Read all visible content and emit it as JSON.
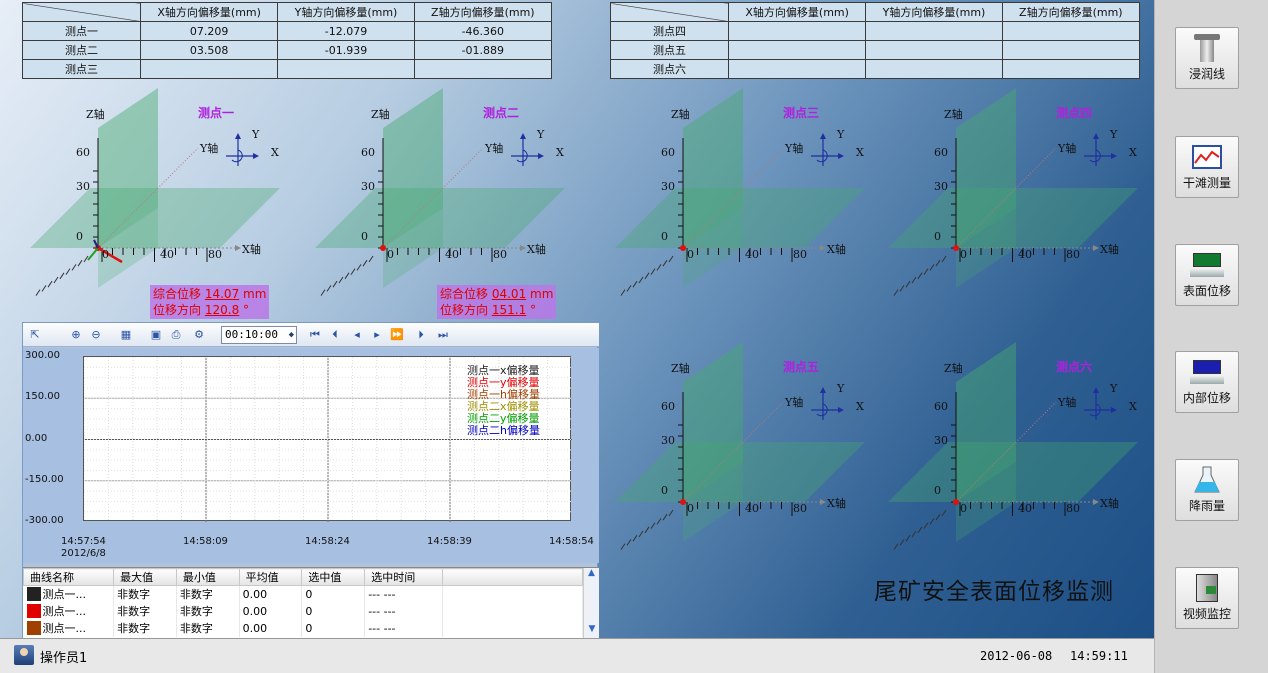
{
  "table_left": {
    "headers": [
      "X轴方向偏移量(mm)",
      "Y轴方向偏移量(mm)",
      "Z轴方向偏移量(mm)"
    ],
    "rows": [
      {
        "name": "测点一",
        "x": "07.209",
        "y": "-12.079",
        "z": "-46.360"
      },
      {
        "name": "测点二",
        "x": "03.508",
        "y": "-01.939",
        "z": "-01.889"
      },
      {
        "name": "测点三",
        "x": "",
        "y": "",
        "z": ""
      }
    ]
  },
  "table_right": {
    "headers": [
      "X轴方向偏移量(mm)",
      "Y轴方向偏移量(mm)",
      "Z轴方向偏移量(mm)"
    ],
    "rows": [
      {
        "name": "测点四",
        "x": "",
        "y": "",
        "z": ""
      },
      {
        "name": "测点五",
        "x": "",
        "y": "",
        "z": ""
      },
      {
        "name": "测点六",
        "x": "",
        "y": "",
        "z": ""
      }
    ]
  },
  "axis_labels": {
    "z": "Z轴",
    "y": "Y轴",
    "x": "X轴",
    "ax_y": "Y",
    "ax_x": "X",
    "z60": "60",
    "z30": "30",
    "z0": "0",
    "x0": "0",
    "x40": "40",
    "x80": "80"
  },
  "plots": [
    {
      "title": "测点一"
    },
    {
      "title": "测点二"
    },
    {
      "title": "测点三"
    },
    {
      "title": "测点四"
    },
    {
      "title": "测点五"
    },
    {
      "title": "测点六"
    }
  ],
  "info1": {
    "disp_label": "综合位移",
    "disp_value": "14.07",
    "disp_unit": "mm",
    "dir_label": "位移方向",
    "dir_value": "120.8",
    "dir_unit": "°"
  },
  "info2": {
    "disp_label": "综合位移",
    "disp_value": "04.01",
    "disp_unit": "mm",
    "dir_label": "位移方向",
    "dir_value": "151.1",
    "dir_unit": "°"
  },
  "toolbar": {
    "time": "00:10:00"
  },
  "chart_data": {
    "type": "line",
    "ylim": [
      -300,
      300
    ],
    "yticks": [
      "300.00",
      "150.00",
      "0.00",
      "-150.00",
      "-300.00"
    ],
    "xticks": [
      "14:57:54",
      "14:58:09",
      "14:58:24",
      "14:58:39",
      "14:58:54"
    ],
    "xdate": "2012/6/8",
    "series": [
      {
        "name": "测点一x偏移量",
        "color": "#222222",
        "values": []
      },
      {
        "name": "测点一y偏移量",
        "color": "#e00000",
        "values": []
      },
      {
        "name": "测点一h偏移量",
        "color": "#a04000",
        "values": []
      },
      {
        "name": "测点二x偏移量",
        "color": "#a09000",
        "values": []
      },
      {
        "name": "测点二y偏移量",
        "color": "#00a000",
        "values": []
      },
      {
        "name": "测点二h偏移量",
        "color": "#0000c0",
        "values": []
      }
    ]
  },
  "stats": {
    "headers": [
      "曲线名称",
      "最大值",
      "最小值",
      "平均值",
      "选中值",
      "选中时间"
    ],
    "rows": [
      {
        "name": "测点一...",
        "max": "非数字",
        "min": "非数字",
        "avg": "0.00",
        "sel": "0",
        "time": "--- ---",
        "color": "#222222"
      },
      {
        "name": "测点一...",
        "max": "非数字",
        "min": "非数字",
        "avg": "0.00",
        "sel": "0",
        "time": "--- ---",
        "color": "#e00000"
      },
      {
        "name": "测点一...",
        "max": "非数字",
        "min": "非数字",
        "avg": "0.00",
        "sel": "0",
        "time": "--- ---",
        "color": "#a04000"
      }
    ]
  },
  "page_title": "尾矿安全表面位移监测",
  "side": [
    {
      "label": "浸润线",
      "icon": "pipe-icon"
    },
    {
      "label": "干滩测量",
      "icon": "chart-icon"
    },
    {
      "label": "表面位移",
      "icon": "monitor-green-icon"
    },
    {
      "label": "内部位移",
      "icon": "monitor-blue-icon"
    },
    {
      "label": "降雨量",
      "icon": "flask-icon"
    },
    {
      "label": "视频监控",
      "icon": "camera-icon"
    }
  ],
  "status": {
    "user": "操作员1",
    "date": "2012-06-08",
    "time": "14:59:11"
  }
}
